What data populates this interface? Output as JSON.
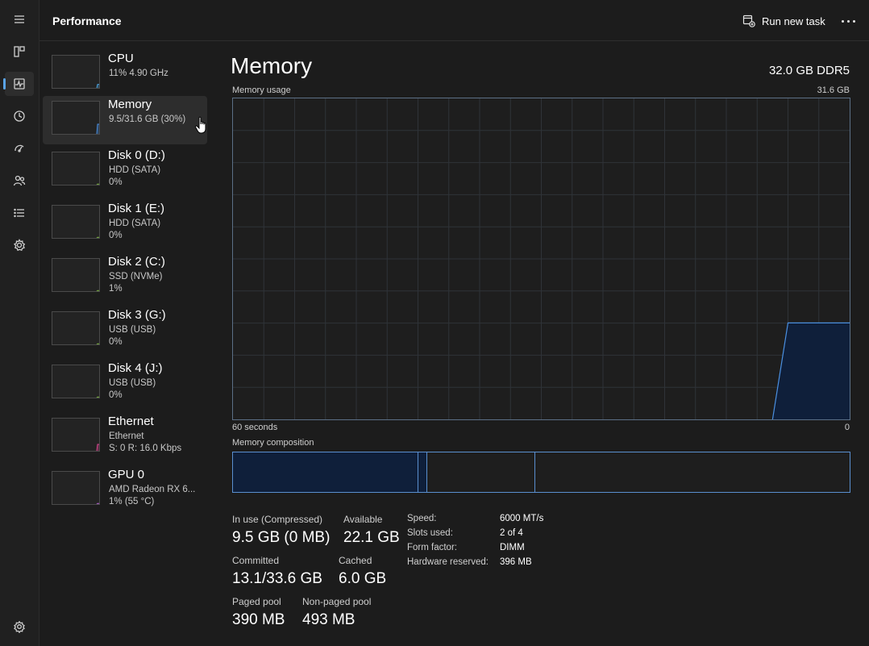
{
  "header": {
    "title": "Performance",
    "run_new_task": "Run new task"
  },
  "rail_icons": [
    "menu-icon",
    "processes-icon",
    "performance-icon",
    "app-history-icon",
    "startup-apps-icon",
    "users-icon",
    "details-icon",
    "services-icon",
    "settings-icon"
  ],
  "devices": [
    {
      "name": "CPU",
      "line1": "11%  4.90 GHz",
      "line2": "",
      "accent": "#4aa3e0",
      "usage_percent": 11
    },
    {
      "name": "Memory",
      "line1": "9.5/31.6 GB (30%)",
      "line2": "",
      "accent": "#4a8fe0",
      "usage_percent": 30
    },
    {
      "name": "Disk 0 (D:)",
      "line1": "HDD (SATA)",
      "line2": "0%",
      "accent": "#7cb342",
      "usage_percent": 0
    },
    {
      "name": "Disk 1 (E:)",
      "line1": "HDD (SATA)",
      "line2": "0%",
      "accent": "#7cb342",
      "usage_percent": 0
    },
    {
      "name": "Disk 2 (C:)",
      "line1": "SSD (NVMe)",
      "line2": "1%",
      "accent": "#7cb342",
      "usage_percent": 1
    },
    {
      "name": "Disk 3 (G:)",
      "line1": "USB (USB)",
      "line2": "0%",
      "accent": "#7cb342",
      "usage_percent": 0
    },
    {
      "name": "Disk 4 (J:)",
      "line1": "USB (USB)",
      "line2": "0%",
      "accent": "#7cb342",
      "usage_percent": 0
    },
    {
      "name": "Ethernet",
      "line1": "Ethernet",
      "line2": "S: 0  R: 16.0 Kbps",
      "accent": "#d9468f",
      "usage_percent": 20
    },
    {
      "name": "GPU 0",
      "line1": "AMD Radeon RX 6...",
      "line2": "1%  (55 °C)",
      "accent": "#b35fd1",
      "usage_percent": 1
    }
  ],
  "detail": {
    "title": "Memory",
    "spec": "32.0 GB DDR5",
    "graph_label": "Memory usage",
    "graph_max": "31.6 GB",
    "graph_time": "60 seconds",
    "graph_zero": "0",
    "composition_label": "Memory composition",
    "composition_fractions": {
      "in_use": 0.3,
      "modified": 0.015,
      "standby": 0.175,
      "free": 0.51
    }
  },
  "chart_data": {
    "type": "area",
    "title": "Memory usage",
    "xlabel": "60 seconds",
    "ylabel": "",
    "ylim": [
      0,
      31.6
    ],
    "x": [
      60,
      55,
      50,
      45,
      40,
      35,
      30,
      25,
      20,
      15,
      10,
      7.5,
      6,
      4,
      2,
      0
    ],
    "values": [
      null,
      null,
      null,
      null,
      null,
      null,
      null,
      null,
      null,
      null,
      null,
      0,
      9.5,
      9.5,
      9.5,
      9.5
    ],
    "grid": true,
    "color": "#4a8fe0"
  },
  "stats": [
    {
      "label": "In use (Compressed)",
      "value": "9.5 GB (0 MB)"
    },
    {
      "label": "Available",
      "value": "22.1 GB"
    },
    {
      "label": "Committed",
      "value": "13.1/33.6 GB"
    },
    {
      "label": "Cached",
      "value": "6.0 GB"
    },
    {
      "label": "Paged pool",
      "value": "390 MB"
    },
    {
      "label": "Non-paged pool",
      "value": "493 MB"
    }
  ],
  "specs": [
    {
      "label": "Speed:",
      "value": "6000 MT/s"
    },
    {
      "label": "Slots used:",
      "value": "2 of 4"
    },
    {
      "label": "Form factor:",
      "value": "DIMM"
    },
    {
      "label": "Hardware reserved:",
      "value": "396 MB"
    }
  ],
  "colors": {
    "accent": "#5aa3e6",
    "memory_line": "#4a8fe0",
    "memory_fill": "#0f1f3a"
  }
}
